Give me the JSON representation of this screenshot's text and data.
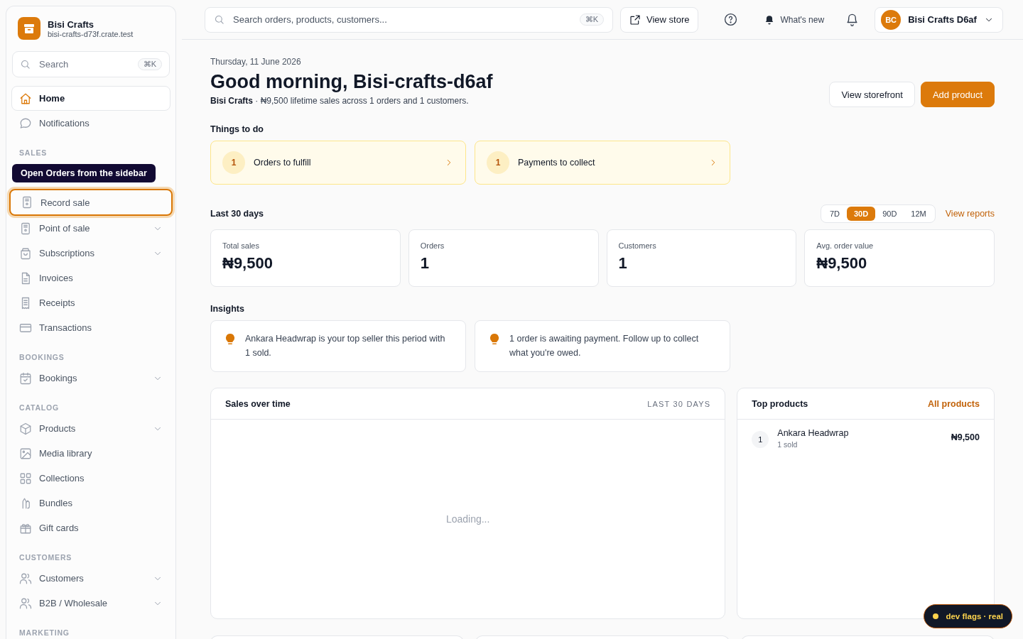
{
  "sidebar": {
    "brand": {
      "name": "Bisi Crafts",
      "domain": "bisi-crafts-d73f.crate.test"
    },
    "search": {
      "placeholder": "Search",
      "shortcut": "⌘K"
    },
    "sections": [
      {
        "items": [
          {
            "label": "Home",
            "selected": true,
            "highlighted": false,
            "expandable": false
          },
          {
            "label": "Notifications",
            "selected": false,
            "highlighted": false,
            "expandable": false
          }
        ]
      },
      {
        "title": "SALES",
        "tooltip": "Open Orders from the sidebar",
        "items": [
          {
            "label": "Record sale",
            "selected": false,
            "highlighted": true,
            "expandable": false
          },
          {
            "label": "Point of sale",
            "selected": false,
            "highlighted": false,
            "expandable": true
          },
          {
            "label": "Subscriptions",
            "selected": false,
            "highlighted": false,
            "expandable": true
          },
          {
            "label": "Invoices",
            "selected": false,
            "highlighted": false,
            "expandable": false
          },
          {
            "label": "Receipts",
            "selected": false,
            "highlighted": false,
            "expandable": false
          },
          {
            "label": "Transactions",
            "selected": false,
            "highlighted": false,
            "expandable": false
          }
        ]
      },
      {
        "title": "BOOKINGS",
        "items": [
          {
            "label": "Bookings",
            "selected": false,
            "highlighted": false,
            "expandable": true
          }
        ]
      },
      {
        "title": "CATALOG",
        "items": [
          {
            "label": "Products",
            "selected": false,
            "highlighted": false,
            "expandable": true
          },
          {
            "label": "Media library",
            "selected": false,
            "highlighted": false,
            "expandable": false
          },
          {
            "label": "Collections",
            "selected": false,
            "highlighted": false,
            "expandable": false
          },
          {
            "label": "Bundles",
            "selected": false,
            "highlighted": false,
            "expandable": false
          },
          {
            "label": "Gift cards",
            "selected": false,
            "highlighted": false,
            "expandable": false
          }
        ]
      },
      {
        "title": "CUSTOMERS",
        "items": [
          {
            "label": "Customers",
            "selected": false,
            "highlighted": false,
            "expandable": true
          },
          {
            "label": "B2B / Wholesale",
            "selected": false,
            "highlighted": false,
            "expandable": true
          }
        ]
      },
      {
        "title": "MARKETING"
      }
    ]
  },
  "topbar": {
    "search": {
      "placeholder": "Search orders, products, customers...",
      "shortcut": "⌘K"
    },
    "view_store": "View store",
    "whats_new": "What's new",
    "account": {
      "initials": "BC",
      "name": "Bisi Crafts D6af"
    }
  },
  "header": {
    "date": "Thursday, 11 June 2026",
    "greeting": "Good morning, Bisi-crafts-d6af",
    "summary": "**Bisi Crafts** · ₦9,500 lifetime sales across 1 orders and 1 customers.",
    "buttons": [
      {
        "label": "View storefront",
        "kind": "secondary"
      },
      {
        "label": "Add product",
        "kind": "primary"
      }
    ]
  },
  "todo": {
    "title": "Things to do",
    "items": [
      {
        "count": "1",
        "label": "Orders to fulfill"
      },
      {
        "count": "1",
        "label": "Payments to collect"
      }
    ]
  },
  "stats": {
    "title": "Last 30 days",
    "periods": [
      {
        "label": "7D",
        "selected": false
      },
      {
        "label": "30D",
        "selected": true
      },
      {
        "label": "90D",
        "selected": false
      },
      {
        "label": "12M",
        "selected": false
      }
    ],
    "link": "View reports",
    "cards": [
      {
        "label": "Total sales",
        "value": "₦9,500"
      },
      {
        "label": "Orders",
        "value": "1"
      },
      {
        "label": "Customers",
        "value": "1"
      },
      {
        "label": "Avg. order value",
        "value": "₦9,500"
      }
    ]
  },
  "insights": {
    "title": "Insights",
    "items": [
      "Ankara Headwrap is your top seller this period with 1 sold.",
      "1 order is awaiting payment. Follow up to collect what you're owed."
    ]
  },
  "sales_over_time": {
    "title": "Sales over time",
    "range": "LAST 30 DAYS",
    "status": "Loading..."
  },
  "top_products": {
    "title": "Top products",
    "link": "All products",
    "items": [
      {
        "rank": "1",
        "name": "Ankara Headwrap",
        "sold": "1 sold",
        "amount": "₦9,500"
      }
    ]
  },
  "dev_badge": "dev flags · real"
}
